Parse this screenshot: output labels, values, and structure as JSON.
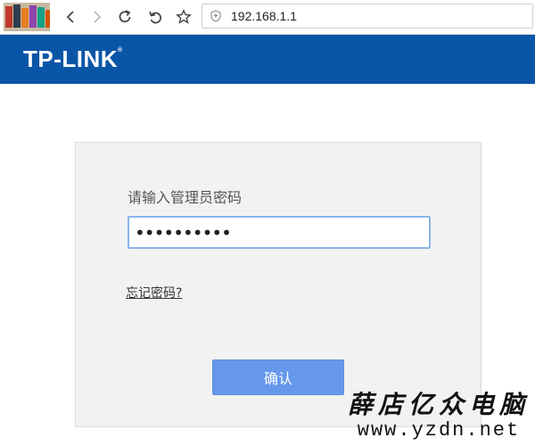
{
  "browser": {
    "back_icon": "back-arrow-icon",
    "forward_icon": "forward-arrow-icon",
    "reload_icon": "reload-icon",
    "undo_icon": "undo-icon",
    "bookmark_icon": "star-icon",
    "security_icon": "shield-icon",
    "url": "192.168.1.1"
  },
  "header": {
    "logo_text": "TP-LINK",
    "logo_mark": "®",
    "background_color": "#0a56a6"
  },
  "login": {
    "prompt_label": "请输入管理员密码",
    "password_value": "••••••••••",
    "forgot_link": "忘记密码?",
    "confirm_label": "确认",
    "button_color": "#6597ea"
  },
  "watermark": {
    "name": "薛店亿众电脑",
    "url": "www.yzdn.net"
  }
}
